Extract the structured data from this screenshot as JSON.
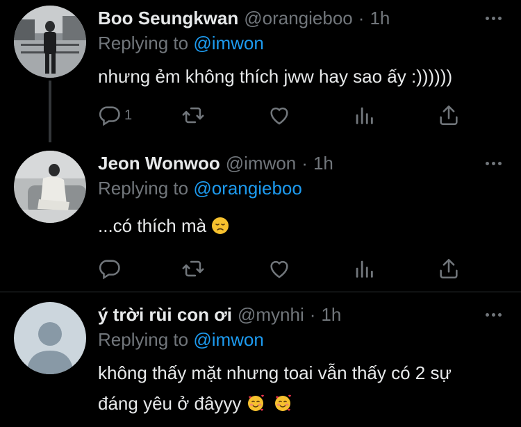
{
  "tweets": [
    {
      "name": "Boo Seungkwan",
      "handle": "@orangieboo",
      "dot": "·",
      "time": "1h",
      "replying_prefix": "Replying to",
      "replying_to": "@imwon",
      "text": "nhưng ẻm không thích jww hay sao ấy :))))))",
      "reply_count": "1",
      "avatar": "user-photo-street"
    },
    {
      "name": "Jeon Wonwoo",
      "handle": "@imwon",
      "dot": "·",
      "time": "1h",
      "replying_prefix": "Replying to",
      "replying_to": "@orangieboo",
      "text": "...có thích mà",
      "reply_count": "",
      "avatar": "user-photo-sofa"
    },
    {
      "name": "ý trời rùi con ơi",
      "handle": "@mynhi",
      "dot": "·",
      "time": "1h",
      "replying_prefix": "Replying to",
      "replying_to": "@imwon",
      "text_line1": "không thấy mặt nhưng toai vẫn thấy có 2 sự",
      "text_line2": "đáng yêu ở đâyyy",
      "avatar": "default-avatar"
    }
  ],
  "icons": {
    "reply": "reply-icon",
    "retweet": "retweet-icon",
    "like": "heart-icon",
    "views": "analytics-icon",
    "share": "share-icon",
    "more": "more-icon",
    "emoji_sad": "disappointed-face-emoji",
    "emoji_love": "smiling-face-with-hearts-emoji"
  },
  "colors": {
    "background": "#000000",
    "text": "#e7e9ea",
    "muted": "#71767b",
    "link": "#1d9bf0",
    "divider": "#2f3336"
  }
}
